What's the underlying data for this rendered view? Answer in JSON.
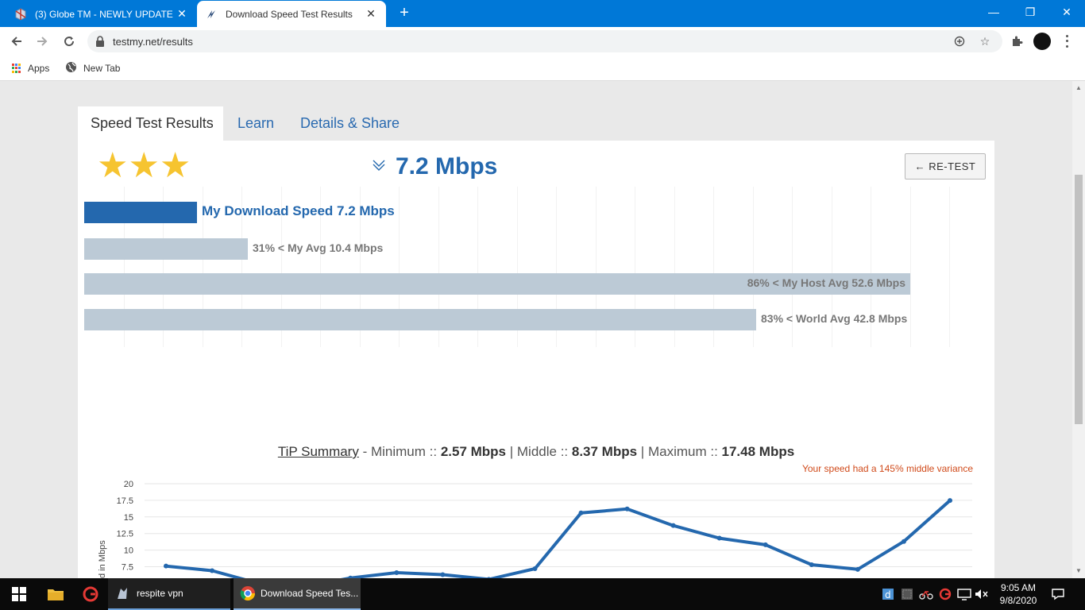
{
  "browser": {
    "tabs": [
      {
        "title": "(3) Globe TM - NEWLY UPDATE [",
        "active": false
      },
      {
        "title": "Download Speed Test Results",
        "active": true
      }
    ],
    "new_tab": "+",
    "window_controls": {
      "minimize": "—",
      "maximize": "❐",
      "close": "✕"
    },
    "url": "testmy.net/results",
    "bookmarks": [
      {
        "label": "Apps",
        "icon": "apps-grid-icon"
      },
      {
        "label": "New Tab",
        "icon": "globe-icon"
      }
    ]
  },
  "page": {
    "tabs": [
      {
        "label": "Speed Test Results",
        "active": true
      },
      {
        "label": "Learn",
        "active": false
      },
      {
        "label": "Details & Share",
        "active": false
      }
    ],
    "rating": {
      "stars": 3,
      "glyphs": "★★★",
      "color": "#f6c430"
    },
    "headline": "7.2 Mbps",
    "retest_label": "← RE-TEST",
    "comparison_bars": [
      {
        "label": "My Download Speed 7.2 Mbps",
        "value": 7.2,
        "color": "#2468ae",
        "label_color": "#2468ae"
      },
      {
        "label": "31% < My Avg 10.4 Mbps",
        "value": 10.4,
        "color": "#bccad6",
        "label_color": "#777777"
      },
      {
        "label": "86% < My Host Avg 52.6 Mbps",
        "value": 52.6,
        "color": "#bccad6",
        "label_color": "#777777"
      },
      {
        "label": "83% < World Avg 42.8 Mbps",
        "value": 42.8,
        "color": "#bccad6",
        "label_color": "#777777"
      }
    ],
    "summary": {
      "tip_label": "TiP Summary",
      "sep_dash": " - ",
      "minimum_label": "Minimum :: ",
      "minimum_value": "2.57 Mbps",
      "pipe1": " | ",
      "middle_label": "Middle :: ",
      "middle_value": "8.37 Mbps",
      "pipe2": " | ",
      "maximum_label": "Maximum :: ",
      "maximum_value": "17.48 Mbps"
    },
    "variance_note": "Your speed had a 145% middle variance"
  },
  "chart_data": {
    "type": "line",
    "ylabel": "Speed in Mbps",
    "yticks": [
      20,
      17.5,
      15,
      12.5,
      10,
      7.5
    ],
    "ylim": [
      0,
      20
    ],
    "grid": true,
    "series": [
      {
        "values": [
          7.6,
          6.9,
          5.0,
          4.5,
          5.8,
          6.6,
          6.3,
          5.6,
          7.2,
          15.6,
          16.2,
          13.7,
          11.8,
          10.8,
          7.8,
          7.1,
          11.3,
          17.48
        ],
        "color": "#2468ae"
      }
    ]
  },
  "taskbar": {
    "items": [
      {
        "label": "",
        "icon": "windows-start-icon"
      },
      {
        "label": "",
        "icon": "file-explorer-icon"
      },
      {
        "label": "",
        "icon": "garena-icon"
      },
      {
        "label": "respite vpn",
        "icon": "vpn-icon"
      },
      {
        "label": "Download Speed Tes...",
        "icon": "chrome-icon"
      }
    ],
    "tray_icons": [
      "dashlane-icon",
      "app-icon",
      "bike-icon",
      "garena-tray-icon",
      "network-icon",
      "volume-muted-icon"
    ],
    "time": "9:05 AM",
    "date": "9/8/2020"
  }
}
